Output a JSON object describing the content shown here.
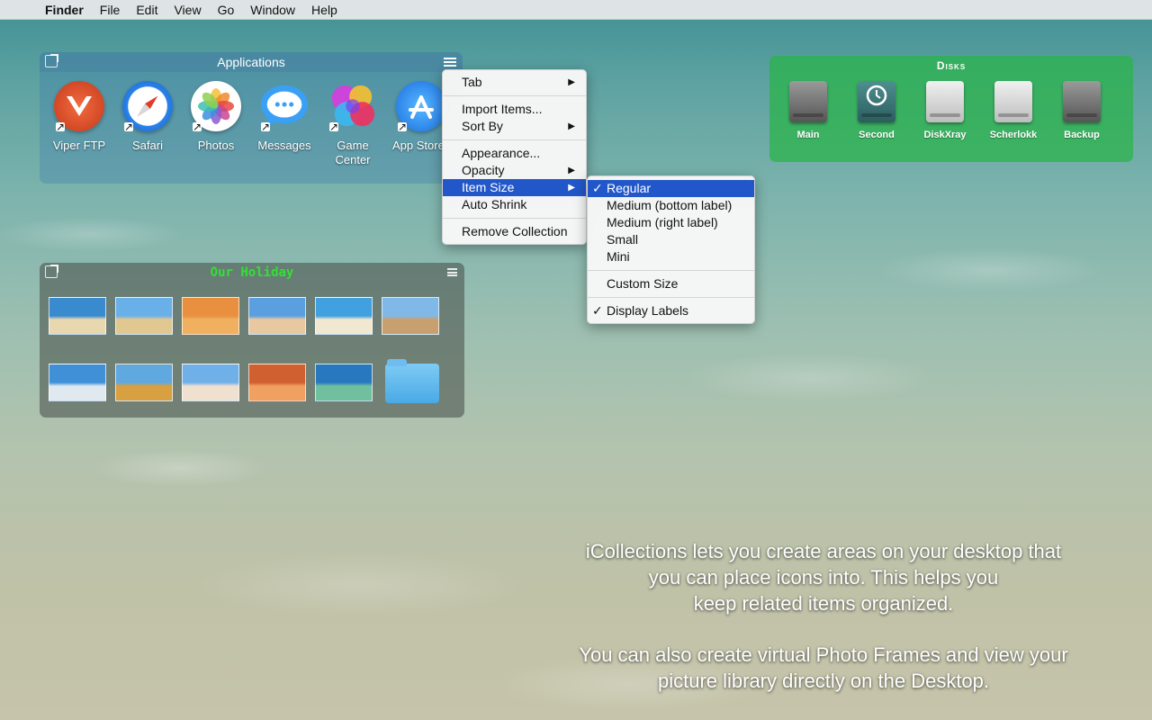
{
  "menubar": {
    "app_name": "Finder",
    "items": [
      "File",
      "Edit",
      "View",
      "Go",
      "Window",
      "Help"
    ]
  },
  "applications": {
    "title": "Applications",
    "apps": [
      {
        "label": "Viper FTP",
        "icon": "viper-ftp-icon",
        "color": "#e04a2a"
      },
      {
        "label": "Safari",
        "icon": "safari-icon",
        "color": "#2a7fe0"
      },
      {
        "label": "Photos",
        "icon": "photos-icon",
        "color": "#ffffff"
      },
      {
        "label": "Messages",
        "icon": "messages-icon",
        "color": "#3aa0f5"
      },
      {
        "label": "Game Center",
        "icon": "game-center-icon",
        "color": "#d040c0"
      },
      {
        "label": "App Store",
        "icon": "app-store-icon",
        "color": "#2a8ff0"
      }
    ]
  },
  "context_menu": {
    "items": [
      {
        "label": "Tab",
        "submenu": true
      },
      {
        "label": "Import Items...",
        "submenu": false
      },
      {
        "label": "Sort By",
        "submenu": true
      },
      {
        "label": "Appearance...",
        "submenu": false
      },
      {
        "label": "Opacity",
        "submenu": true
      },
      {
        "label": "Item Size",
        "submenu": true,
        "highlighted": true
      },
      {
        "label": "Auto Shrink",
        "submenu": false
      },
      {
        "label": "Remove Collection",
        "submenu": false
      }
    ]
  },
  "size_submenu": {
    "items": [
      {
        "label": "Regular",
        "checked": true,
        "highlighted": true
      },
      {
        "label": "Medium (bottom label)",
        "checked": false
      },
      {
        "label": "Medium (right label)",
        "checked": false
      },
      {
        "label": "Small",
        "checked": false
      },
      {
        "label": "Mini",
        "checked": false
      },
      {
        "label": "Custom Size",
        "checked": false
      },
      {
        "label": "Display Labels",
        "checked": true
      }
    ]
  },
  "holiday": {
    "title": "Our Holiday",
    "photo_colors": [
      [
        "#3a8ad0",
        "#e8d8b0"
      ],
      [
        "#6ab0e8",
        "#e0c890"
      ],
      [
        "#e89040",
        "#f0b060"
      ],
      [
        "#5aa0e0",
        "#e8c8a0"
      ],
      [
        "#40a0e0",
        "#f0e8d0"
      ],
      [
        "#80b8e8",
        "#c8a070"
      ],
      [
        "#4090d8",
        "#e0e8f0"
      ],
      [
        "#60a8e0",
        "#d8a040"
      ],
      [
        "#70b0e8",
        "#f0e0d0"
      ],
      [
        "#d06030",
        "#f0a060"
      ],
      [
        "#2878c0",
        "#70c0a0"
      ]
    ]
  },
  "disks": {
    "title": "Disks",
    "items": [
      "Main",
      "Second",
      "DiskXray",
      "Scherlokk",
      "Backup"
    ]
  },
  "caption": {
    "line1": "iCollections lets you create areas on your desktop that",
    "line2": "you can place icons into. This helps you",
    "line3": "keep related items organized.",
    "line4": "You can also create virtual Photo Frames and view your",
    "line5": "picture library directly on the Desktop."
  }
}
